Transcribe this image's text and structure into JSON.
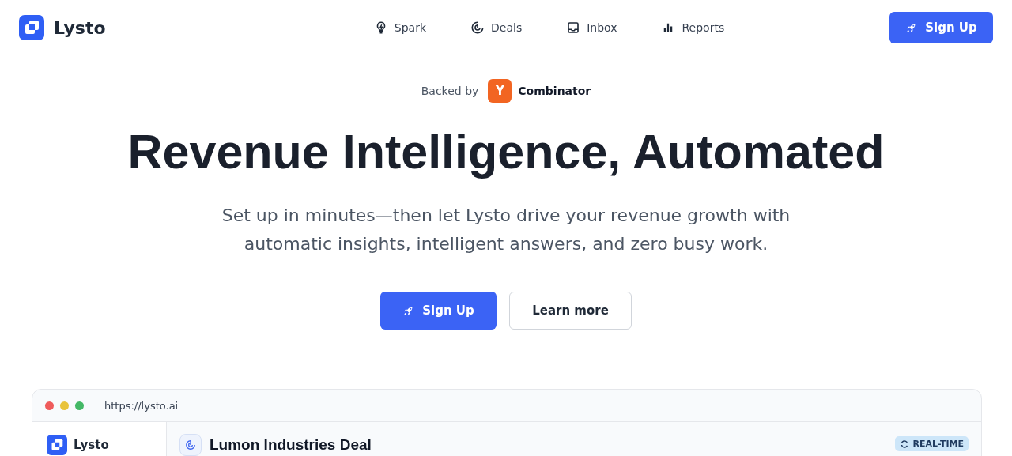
{
  "header": {
    "brand": "Lysto",
    "nav": [
      {
        "label": "Spark"
      },
      {
        "label": "Deals"
      },
      {
        "label": "Inbox"
      },
      {
        "label": "Reports"
      }
    ],
    "cta": "Sign Up"
  },
  "hero": {
    "backed_by": "Backed by",
    "badge_letter": "Y",
    "badge_name": "Combinator",
    "title": "Revenue Intelligence, Automated",
    "subtitle": "Set up in minutes—then let Lysto drive your revenue growth with automatic insights, intelligent answers, and zero busy work.",
    "primary_button": "Sign Up",
    "secondary_button": "Learn more"
  },
  "preview": {
    "url": "https://lysto.ai",
    "sidebar_brand": "Lysto",
    "deal_title": "Lumon Industries Deal",
    "status_badge": "REAL-TIME"
  }
}
